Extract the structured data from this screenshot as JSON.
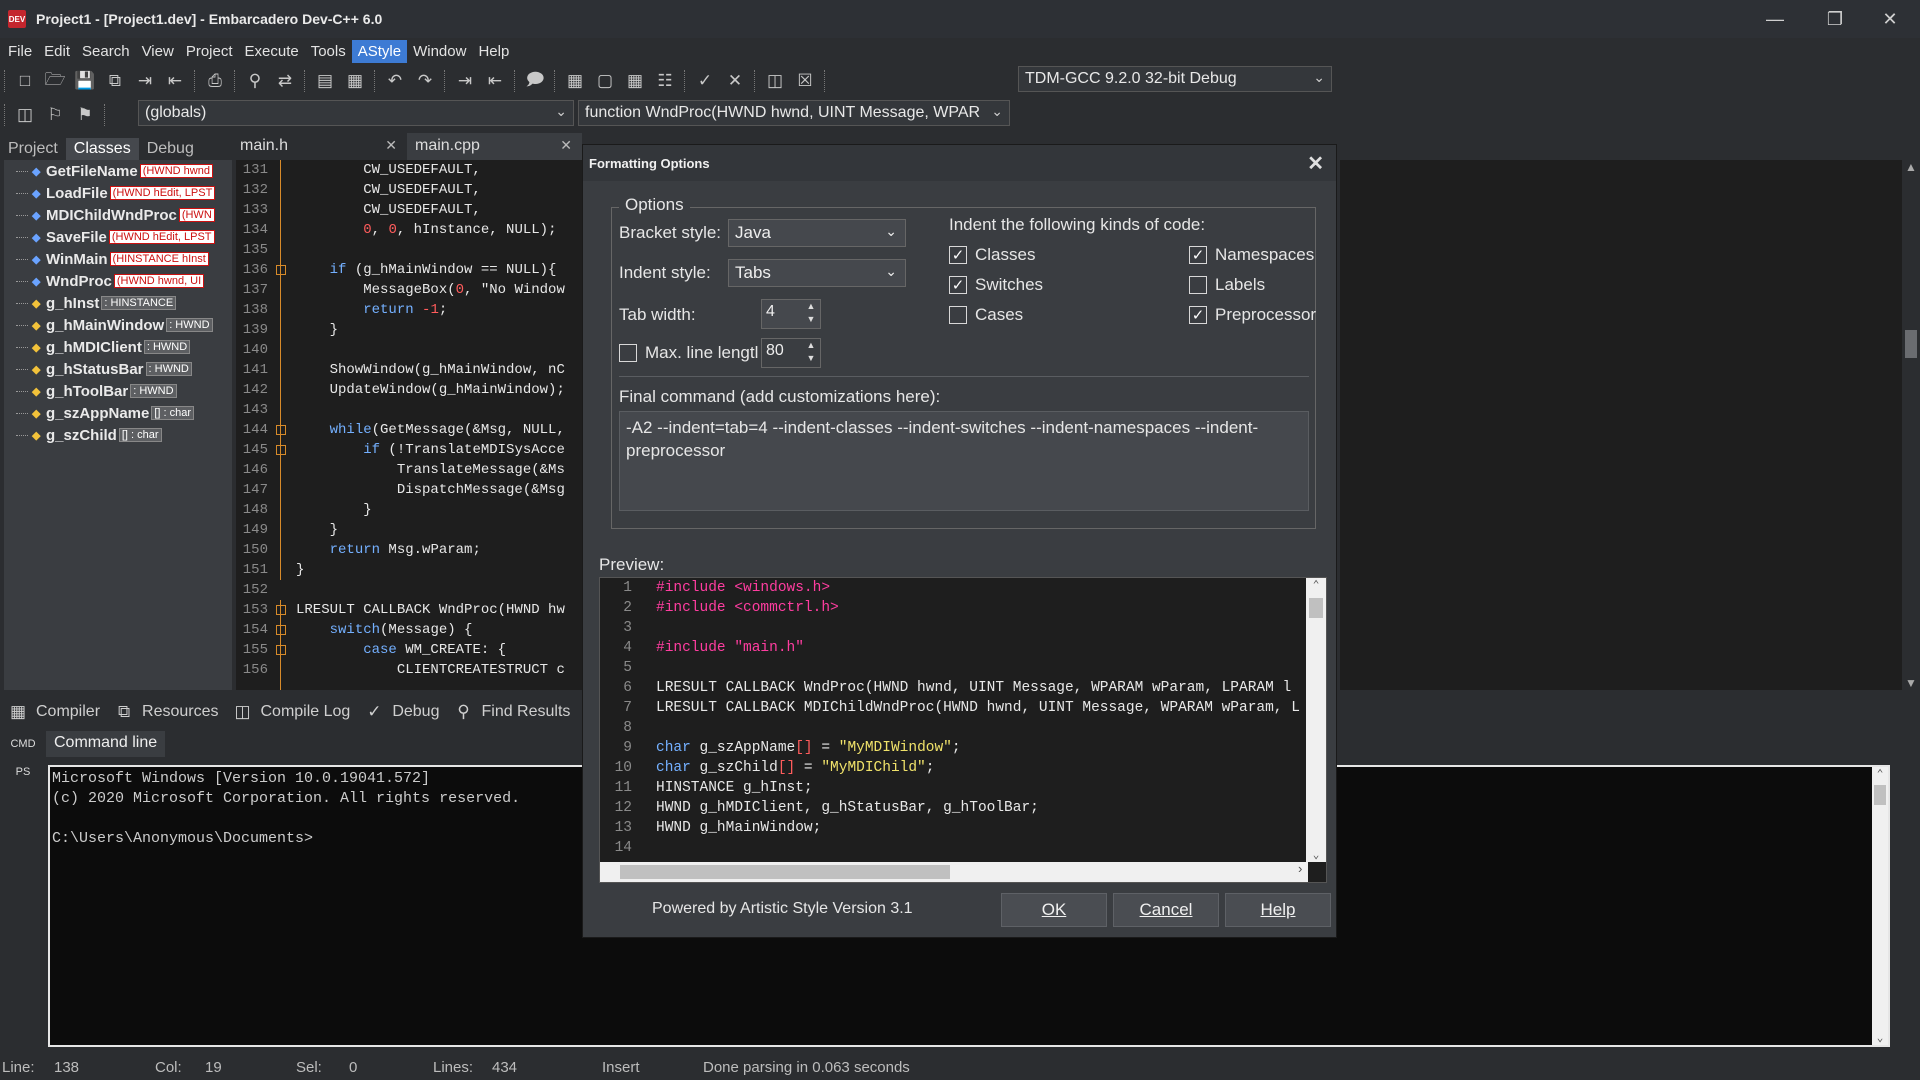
{
  "window": {
    "title": "Project1 - [Project1.dev] - Embarcadero Dev-C++ 6.0",
    "icon_text": "DEV",
    "controls": [
      "minimize-icon",
      "restore-icon",
      "close-icon"
    ]
  },
  "menu": [
    "File",
    "Edit",
    "Search",
    "View",
    "Project",
    "Execute",
    "Tools",
    "AStyle",
    "Window",
    "Help"
  ],
  "toolbar": {
    "compiler_combo": "TDM-GCC 9.2.0 32-bit Debug",
    "scope_combo": "(globals)",
    "function_combo": "function WndProc(HWND hwnd, UINT Message, WPAR"
  },
  "left_panel": {
    "tabs": [
      "Project",
      "Classes",
      "Debug"
    ],
    "items": [
      {
        "name": "GetFileName",
        "sig": "(HWND hwnd",
        "kind": "func"
      },
      {
        "name": "LoadFile",
        "sig": "(HWND hEdit, LPST",
        "kind": "func"
      },
      {
        "name": "MDIChildWndProc",
        "sig": "(HWN",
        "kind": "func"
      },
      {
        "name": "SaveFile",
        "sig": "(HWND hEdit, LPST",
        "kind": "func"
      },
      {
        "name": "WinMain",
        "sig": "(HINSTANCE hInst",
        "kind": "func"
      },
      {
        "name": "WndProc",
        "sig": "(HWND hwnd, UI",
        "kind": "func"
      },
      {
        "name": "g_hInst",
        "sig": ": HINSTANCE",
        "kind": "var"
      },
      {
        "name": "g_hMainWindow",
        "sig": ": HWND",
        "kind": "var"
      },
      {
        "name": "g_hMDIClient",
        "sig": ": HWND",
        "kind": "var"
      },
      {
        "name": "g_hStatusBar",
        "sig": ": HWND",
        "kind": "var"
      },
      {
        "name": "g_hToolBar",
        "sig": ": HWND",
        "kind": "var"
      },
      {
        "name": "g_szAppName",
        "sig": "[] : char",
        "kind": "var"
      },
      {
        "name": "g_szChild",
        "sig": "[] : char",
        "kind": "var"
      }
    ]
  },
  "editor": {
    "tabs": [
      "main.h",
      "main.cpp"
    ],
    "lines": [
      {
        "n": "131",
        "code": "        CW_USEDEFAULT,"
      },
      {
        "n": "132",
        "code": "        CW_USEDEFAULT,"
      },
      {
        "n": "133",
        "code": "        CW_USEDEFAULT,"
      },
      {
        "n": "134",
        "code": "        0, 0, hInstance, NULL);"
      },
      {
        "n": "135",
        "code": ""
      },
      {
        "n": "136",
        "code": "    if (g_hMainWindow == NULL){"
      },
      {
        "n": "137",
        "code": "        MessageBox(0, \"No Window"
      },
      {
        "n": "138",
        "code": "        return -1;"
      },
      {
        "n": "139",
        "code": "    }"
      },
      {
        "n": "140",
        "code": ""
      },
      {
        "n": "141",
        "code": "    ShowWindow(g_hMainWindow, nC"
      },
      {
        "n": "142",
        "code": "    UpdateWindow(g_hMainWindow);"
      },
      {
        "n": "143",
        "code": ""
      },
      {
        "n": "144",
        "code": "    while(GetMessage(&Msg, NULL,"
      },
      {
        "n": "145",
        "code": "        if (!TranslateMDISysAcce"
      },
      {
        "n": "146",
        "code": "            TranslateMessage(&Ms"
      },
      {
        "n": "147",
        "code": "            DispatchMessage(&Msg"
      },
      {
        "n": "148",
        "code": "        }"
      },
      {
        "n": "149",
        "code": "    }"
      },
      {
        "n": "150",
        "code": "    return Msg.wParam;"
      },
      {
        "n": "151",
        "code": "}"
      },
      {
        "n": "152",
        "code": ""
      },
      {
        "n": "153",
        "code": "LRESULT CALLBACK WndProc(HWND hw"
      },
      {
        "n": "154",
        "code": "    switch(Message) {"
      },
      {
        "n": "155",
        "code": "        case WM_CREATE: {"
      },
      {
        "n": "156",
        "code": "            CLIENTCREATESTRUCT c"
      }
    ]
  },
  "bottom": {
    "tabs": [
      "Compiler",
      "Resources",
      "Compile Log",
      "Debug",
      "Find Results"
    ],
    "side": [
      "CMD",
      "PS"
    ],
    "cmd_tab": "Command line",
    "console": [
      "Microsoft Windows [Version 10.0.19041.572]",
      "(c) 2020 Microsoft Corporation. All rights reserved.",
      "",
      "C:\\Users\\Anonymous\\Documents>"
    ]
  },
  "status": {
    "line_label": "Line:",
    "line": "138",
    "col_label": "Col:",
    "col": "19",
    "sel_label": "Sel:",
    "sel": "0",
    "lines_label": "Lines:",
    "lines": "434",
    "mode": "Insert",
    "message": "Done parsing in 0.063 seconds"
  },
  "dialog": {
    "title": "Formatting Options",
    "group": "Options",
    "bracket_label": "Bracket style:",
    "bracket_value": "Java",
    "indent_label": "Indent style:",
    "indent_value": "Tabs",
    "tab_width_label": "Tab width:",
    "tab_width": "4",
    "max_line_label": "Max. line lengtl",
    "max_line_value": "80",
    "max_line_checked": false,
    "indent_kinds_label": "Indent the following kinds of code:",
    "checkboxes": [
      {
        "label": "Classes",
        "checked": true
      },
      {
        "label": "Namespaces",
        "checked": true
      },
      {
        "label": "Switches",
        "checked": true
      },
      {
        "label": "Labels",
        "checked": false
      },
      {
        "label": "Cases",
        "checked": false
      },
      {
        "label": "Preprocessor",
        "checked": true
      }
    ],
    "final_label": "Final command (add customizations here):",
    "final_command": "-A2 --indent=tab=4 --indent-classes --indent-switches --indent-namespaces --indent-preprocessor",
    "preview_label": "Preview:",
    "preview": [
      {
        "n": "1",
        "code": "#include <windows.h>"
      },
      {
        "n": "2",
        "code": "#include <commctrl.h>"
      },
      {
        "n": "3",
        "code": ""
      },
      {
        "n": "4",
        "code": "#include \"main.h\""
      },
      {
        "n": "5",
        "code": ""
      },
      {
        "n": "6",
        "code": "LRESULT CALLBACK WndProc(HWND hwnd, UINT Message, WPARAM wParam, LPARAM l"
      },
      {
        "n": "7",
        "code": "LRESULT CALLBACK MDIChildWndProc(HWND hwnd, UINT Message, WPARAM wParam, L"
      },
      {
        "n": "8",
        "code": ""
      },
      {
        "n": "9",
        "code": "char g_szAppName[] = \"MyMDIWindow\";"
      },
      {
        "n": "10",
        "code": "char g_szChild[] = \"MyMDIChild\";"
      },
      {
        "n": "11",
        "code": "HINSTANCE g_hInst;"
      },
      {
        "n": "12",
        "code": "HWND g_hMDIClient, g_hStatusBar, g_hToolBar;"
      },
      {
        "n": "13",
        "code": "HWND g_hMainWindow;"
      },
      {
        "n": "14",
        "code": ""
      }
    ],
    "powered_by": "Powered by Artistic Style Version 3.1",
    "ok": "OK",
    "cancel": "Cancel",
    "help": "Help"
  },
  "colors": {
    "accent": "#3d7bd4",
    "keyword": "#74b0ff",
    "preprocessor": "#ff3da0",
    "string": "#f0e26a",
    "number": "#ff5c5c",
    "fold_marker": "#d68a2a"
  }
}
